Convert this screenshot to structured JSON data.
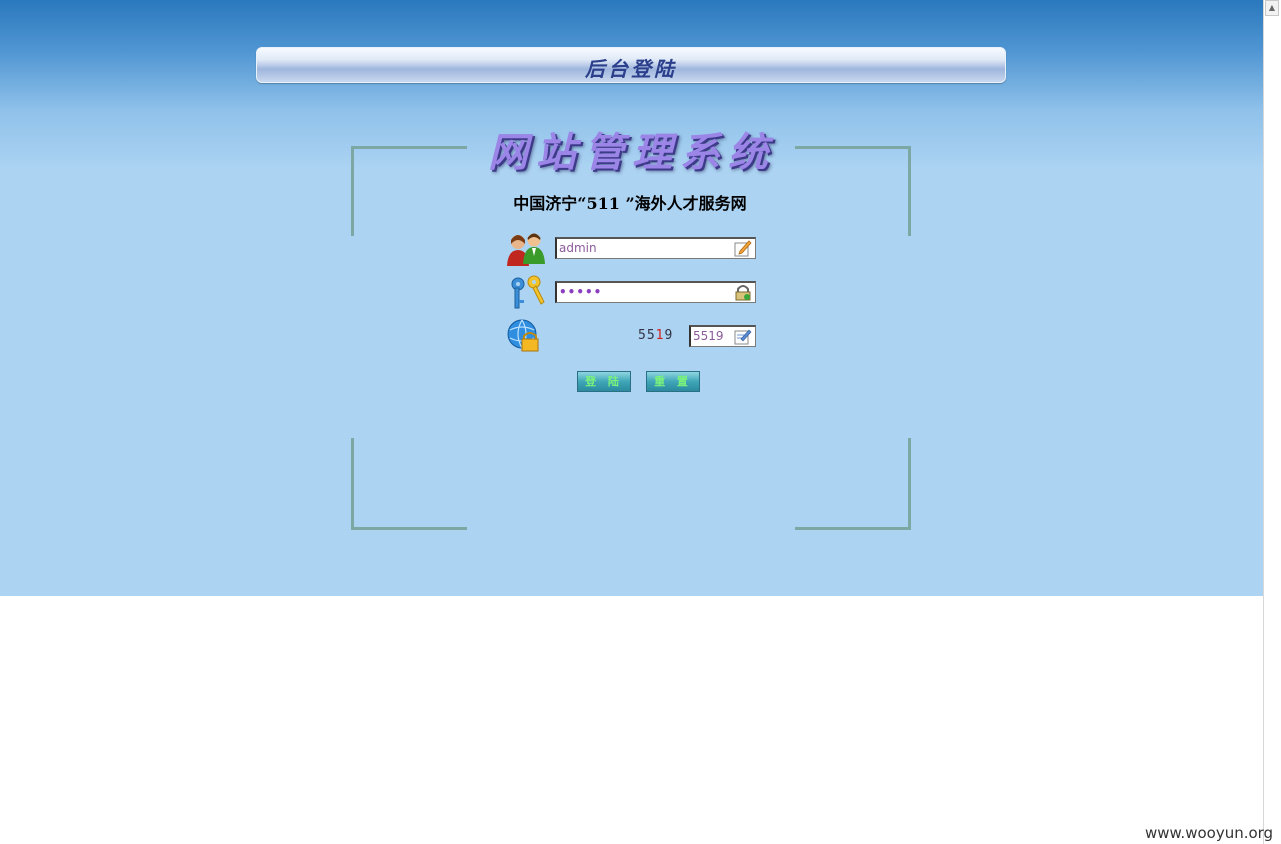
{
  "header": {
    "title": "后台登陆"
  },
  "main": {
    "system_title": "网站管理系统",
    "site_name": "中国济宁“511 ”海外人才服务网"
  },
  "form": {
    "username": {
      "value": "admin",
      "icon": "users-icon",
      "field_icon": "edit-pencil-icon"
    },
    "password": {
      "value": "•••••",
      "icon": "keys-icon",
      "field_icon": "padlock-icon"
    },
    "captcha": {
      "image_digits": [
        "5",
        "5",
        "1",
        "9"
      ],
      "value": "5519",
      "icon": "globe-lock-icon",
      "field_icon": "edit-note-icon"
    },
    "login_button": "登 陆",
    "reset_button": "重 置"
  },
  "watermark": "www.wooyun.org",
  "colors": {
    "backdrop_top": "#2a78bd",
    "backdrop_main": "#acd3f2",
    "title_text": "#2c3f8c",
    "system_title": "#9b86e8",
    "frame": "#7da7a2",
    "button": "#3fa6b8",
    "button_text": "#7bf27b"
  }
}
